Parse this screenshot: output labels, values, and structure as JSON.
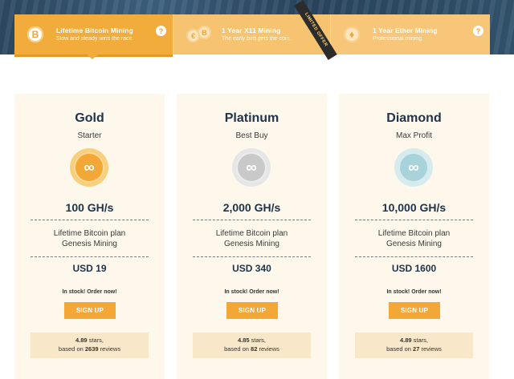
{
  "tabs": [
    {
      "title": "Lifetime Bitcoin Mining",
      "subtitle": "Slow and steady wins the race.",
      "icon": "bitcoin-icon",
      "coin_glyph": "B",
      "help": "?"
    },
    {
      "title": "1 Year X11 Mining",
      "subtitle": "The early bird gets the coin.",
      "icon": "coins-icon",
      "coin_glyph_a": "€",
      "coin_glyph_b": "B",
      "ribbon": "LIMITED OFFER"
    },
    {
      "title": "1 Year Ether Mining",
      "subtitle": "Professional mining",
      "icon": "ether-icon",
      "coin_glyph": "♦",
      "help": "?"
    }
  ],
  "plans": [
    {
      "name": "Gold",
      "tagline": "Starter",
      "badge_symbol": "∞",
      "badge_color": "#f2a737",
      "hashrate": "100 GH/s",
      "desc_line1": "Lifetime Bitcoin plan",
      "desc_line2": "Genesis Mining",
      "price": "USD 19",
      "stock": "In stock! Order now!",
      "signup": "SIGN UP",
      "stars": "4.89",
      "stars_suffix": " stars,",
      "reviews_prefix": "based on ",
      "reviews_count": "2639",
      "reviews_suffix": " reviews"
    },
    {
      "name": "Platinum",
      "tagline": "Best Buy",
      "badge_symbol": "∞",
      "badge_color": "#c9c9c9",
      "hashrate": "2,000 GH/s",
      "desc_line1": "Lifetime Bitcoin plan",
      "desc_line2": "Genesis Mining",
      "price": "USD 340",
      "stock": "In stock! Order now!",
      "signup": "SIGN UP",
      "stars": "4.85",
      "stars_suffix": " stars,",
      "reviews_prefix": "based on ",
      "reviews_count": "82",
      "reviews_suffix": " reviews"
    },
    {
      "name": "Diamond",
      "tagline": "Max Profit",
      "badge_symbol": "∞",
      "badge_color": "#a8d3da",
      "hashrate": "10,000 GH/s",
      "desc_line1": "Lifetime Bitcoin plan",
      "desc_line2": "Genesis Mining",
      "price": "USD 1600",
      "stock": "In stock! Order now!",
      "signup": "SIGN UP",
      "stars": "4.89",
      "stars_suffix": " stars,",
      "reviews_prefix": "based on ",
      "reviews_count": "27",
      "reviews_suffix": " reviews"
    }
  ],
  "colors": {
    "accent": "#f2a737",
    "heading": "#20344a",
    "card_bg": "#fdf7ec"
  }
}
